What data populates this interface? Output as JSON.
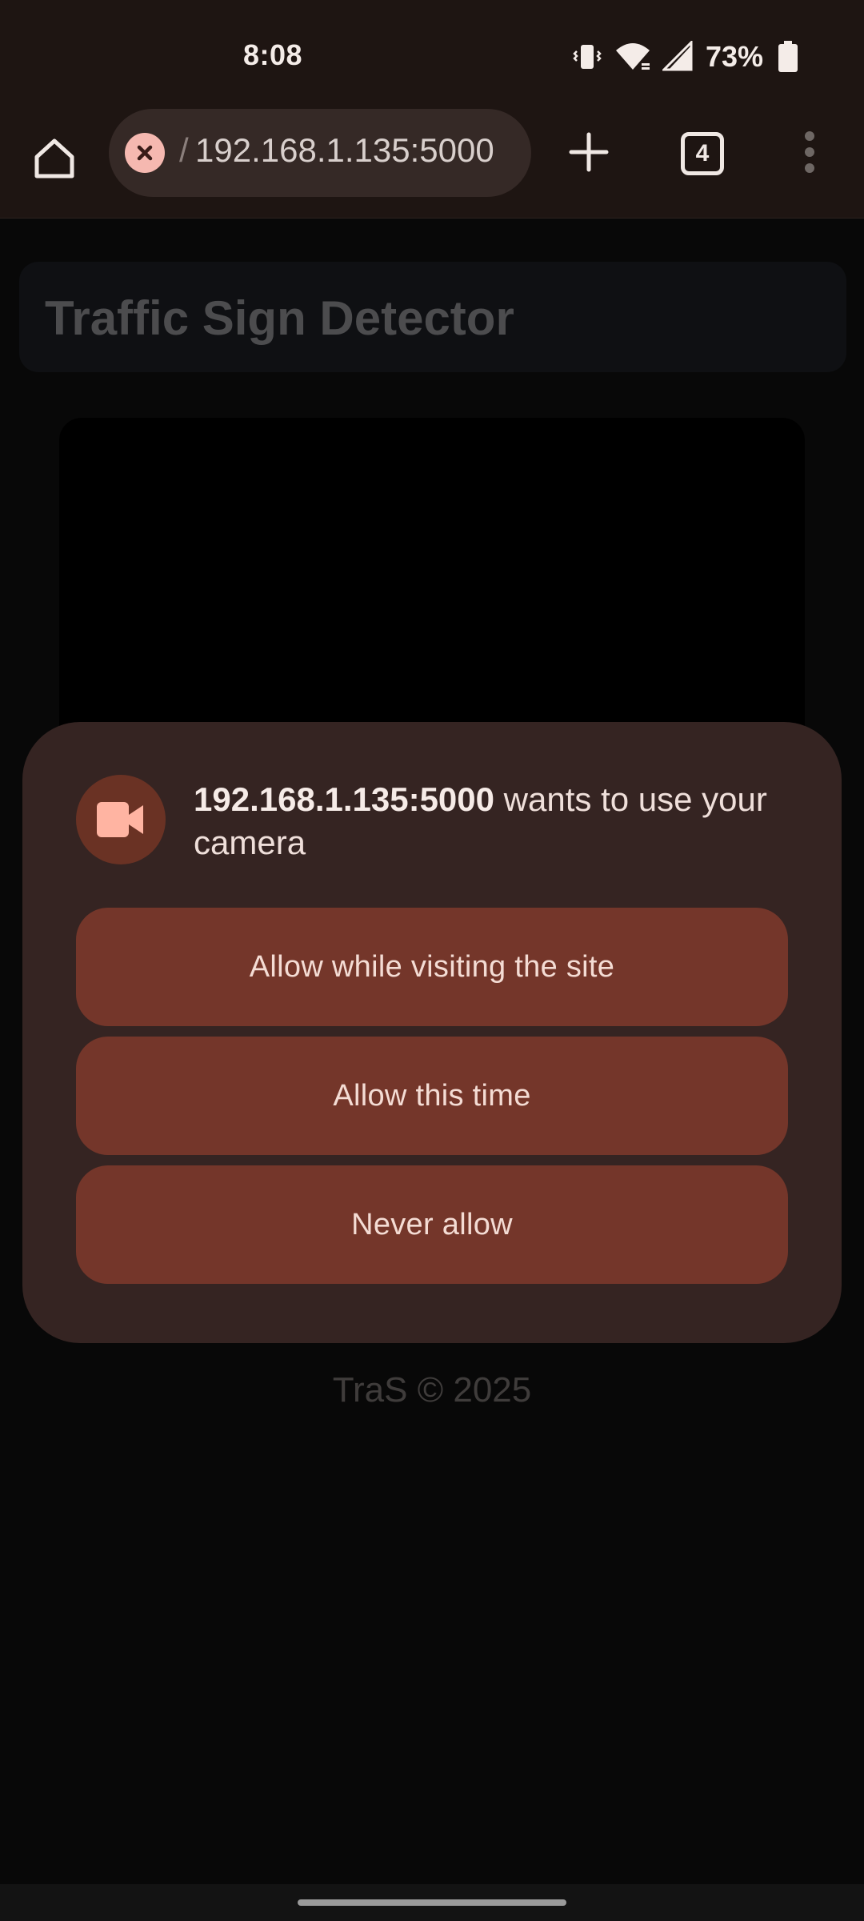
{
  "status_bar": {
    "time": "8:08",
    "battery_percent": "73%",
    "icons": [
      "vibrate-icon",
      "wifi-icon",
      "cell-signal-icon",
      "battery-icon"
    ]
  },
  "browser": {
    "url_prefix": "/",
    "url": "192.168.1.135:5000",
    "tab_count": "4",
    "security_state": "not-secure",
    "icons": [
      "home-icon",
      "not-secure-icon",
      "plus-icon",
      "tab-switcher-icon",
      "more-vert-icon"
    ]
  },
  "page": {
    "title": "Traffic Sign Detector",
    "footer": "TraS © 2025"
  },
  "permission_dialog": {
    "host": "192.168.1.135:5000",
    "message_rest": " wants to use your camera",
    "icon": "videocam-icon",
    "buttons": {
      "allow_site": "Allow while visiting the site",
      "allow_once": "Allow this time",
      "never": "Never allow"
    }
  },
  "colors": {
    "toolbar_bg": "#1e1512",
    "dialog_bg": "#352422",
    "button_bg": "#74362a",
    "icon_accent": "#ffb4a2"
  }
}
